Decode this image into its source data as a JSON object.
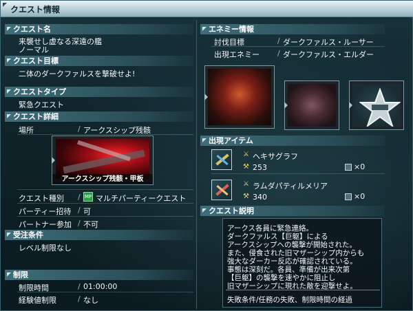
{
  "window": {
    "title": "クエスト情報"
  },
  "quest_name": {
    "header": "クエスト名",
    "line1": "来襲せし虚なる深遠の艦",
    "line2": "ノーマル"
  },
  "quest_goal": {
    "header": "クエスト目標",
    "text": "二体のダークファルスを撃破せよ!"
  },
  "quest_type": {
    "header": "クエストタイプ",
    "text": "緊急クエスト"
  },
  "quest_detail": {
    "header": "クエスト詳細",
    "place_label": "場所",
    "place_value": "アークスシップ残骸",
    "area_caption": "アークスシップ残骸・甲板",
    "kind_label": "クエスト種別",
    "kind_value": "マルチパーティークエスト",
    "kind_icon": "multi-party-icon",
    "party_invite_label": "パーティー招待",
    "party_invite_value": "可",
    "partner_label": "パートナー参加",
    "partner_value": "不可"
  },
  "conditions": {
    "header": "受注条件",
    "text": "レベル制限なし"
  },
  "limits": {
    "header": "制限",
    "time_label": "制限時間",
    "time_value": "01:00:00",
    "exp_label": "経験値制限",
    "exp_value": "なし"
  },
  "enemy_info": {
    "header": "エネミー情報",
    "target_label": "討伐目標",
    "target_value": "ダークファルス・ルーサー",
    "appear_label": "出現エネミー",
    "appear_value": "ダークファルス・エルダー",
    "star_icon": "star-badge-icon"
  },
  "items": {
    "header": "出現アイテム",
    "list": [
      {
        "name": "ヘキサグラフ",
        "atk": "253",
        "count": "×0",
        "icon": "dual-blade-icon"
      },
      {
        "name": "ラムダパティルメリア",
        "atk": "340",
        "count": "×0",
        "icon": "twin-sword-icon"
      }
    ]
  },
  "description": {
    "header": "クエスト説明",
    "lines": [
      "アークス各員に緊急連絡。",
      "ダークファルス【巨躯】による",
      "アークスシップへの襲撃が開始された。",
      "また、侵食された旧マザーシップ内からも",
      "強大なダーカー反応が確認されている。",
      "事態は深刻だ。各員、準備が出来次第",
      "【巨躯】の襲撃を速やかに阻止し",
      "旧マザーシップに現れた敵を迎撃せよ。"
    ],
    "fail": "失敗条件/任務の失敗、制限時間の経過"
  }
}
